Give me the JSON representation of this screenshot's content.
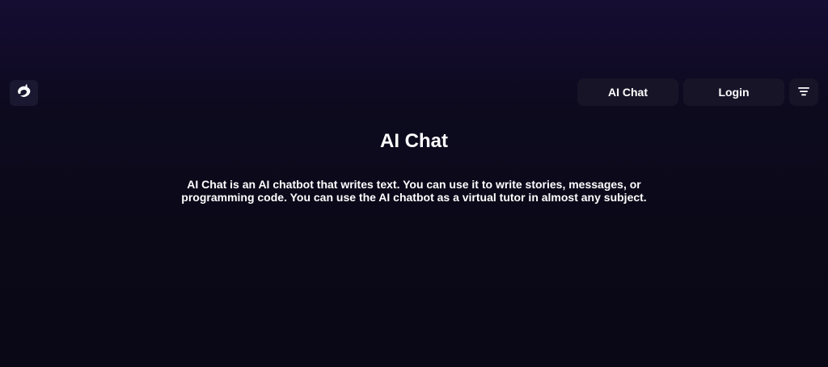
{
  "header": {
    "logo_icon": "dolphin-logo-icon",
    "nav": {
      "ai_chat_label": "AI Chat",
      "login_label": "Login",
      "menu_icon": "hamburger-menu-icon"
    }
  },
  "main": {
    "title": "AI Chat",
    "description": "AI Chat is an AI chatbot that writes text. You can use it to write stories, messages, or programming code. You can use the AI chatbot as a virtual tutor in almost any subject."
  },
  "colors": {
    "background_top": "#160d33",
    "background_bottom": "#0a0816",
    "button_bg": "#171428",
    "text": "#ffffff"
  }
}
